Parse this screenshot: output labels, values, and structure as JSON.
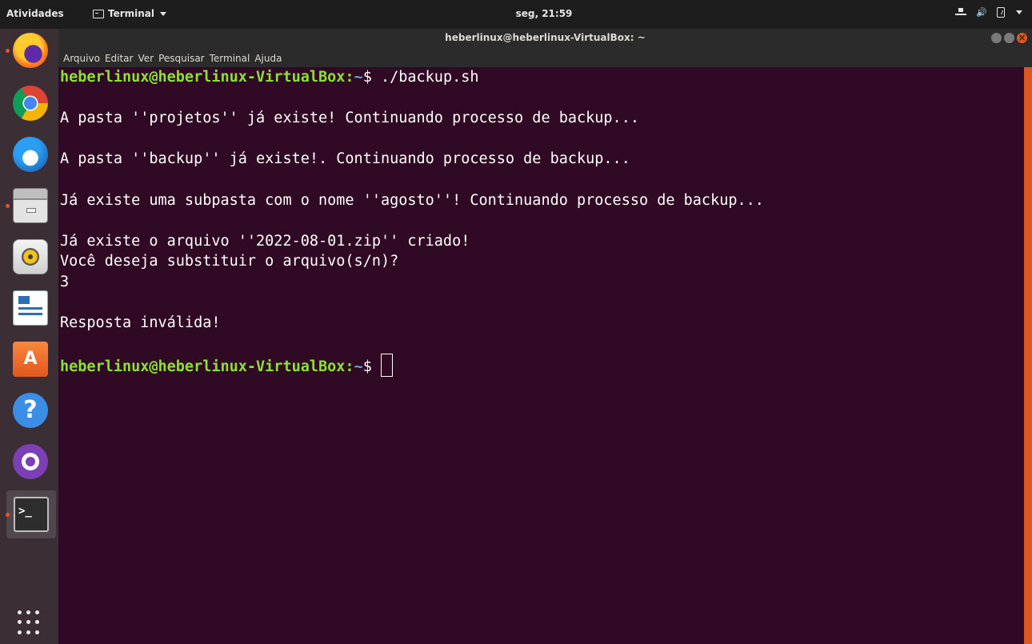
{
  "topbar": {
    "activities": "Atividades",
    "app_menu": "Terminal",
    "clock": "seg, 21:59",
    "tray_icons": [
      "network-icon",
      "volume-icon",
      "battery-icon",
      "system-menu-caret"
    ]
  },
  "dock": {
    "items": [
      {
        "name": "firefox",
        "icon": "firefox-icon",
        "running": true
      },
      {
        "name": "chrome",
        "icon": "chrome-icon",
        "running": false
      },
      {
        "name": "thunderbird",
        "icon": "thunderbird-icon",
        "running": false
      },
      {
        "name": "files",
        "icon": "files-icon",
        "running": true
      },
      {
        "name": "rhythmbox",
        "icon": "rhythmbox-icon",
        "running": false
      },
      {
        "name": "libreoffice-writer",
        "icon": "writer-icon",
        "running": false
      },
      {
        "name": "ubuntu-software",
        "icon": "software-icon",
        "running": false
      },
      {
        "name": "help",
        "icon": "help-icon",
        "running": false
      },
      {
        "name": "github",
        "icon": "github-icon",
        "running": false
      },
      {
        "name": "terminal",
        "icon": "terminal-icon",
        "running": true,
        "active": true
      }
    ],
    "software_glyph": "A",
    "help_glyph": "?",
    "terminal_glyph": ">_",
    "show_apps_icon": "grid-icon"
  },
  "window": {
    "title": "heberlinux@heberlinux-VirtualBox: ~",
    "menu": [
      "Arquivo",
      "Editar",
      "Ver",
      "Pesquisar",
      "Terminal",
      "Ajuda"
    ]
  },
  "terminal": {
    "prompt_user": "heberlinux@heberlinux-VirtualBox",
    "prompt_colon": ":",
    "prompt_path": "~",
    "prompt_symbol": "$ ",
    "command": "./backup.sh",
    "output": [
      "",
      "A pasta ''projetos'' já existe! Continuando processo de backup...",
      "",
      "A pasta ''backup'' já existe!. Continuando processo de backup...",
      "",
      "Já existe uma subpasta com o nome ''agosto''! Continuando processo de backup...",
      "",
      "Já existe o arquivo ''2022-08-01.zip'' criado!",
      "Você deseja substituir o arquivo(s/n)?",
      "3",
      "",
      "Resposta inválida!",
      ""
    ]
  },
  "colors": {
    "terminal_bg": "#300a24",
    "prompt_user": "#8ae234",
    "prompt_path": "#729fcf",
    "accent": "#e95420",
    "dock_bg": "#3b2e35",
    "topbar_bg": "#1d1d1d"
  }
}
